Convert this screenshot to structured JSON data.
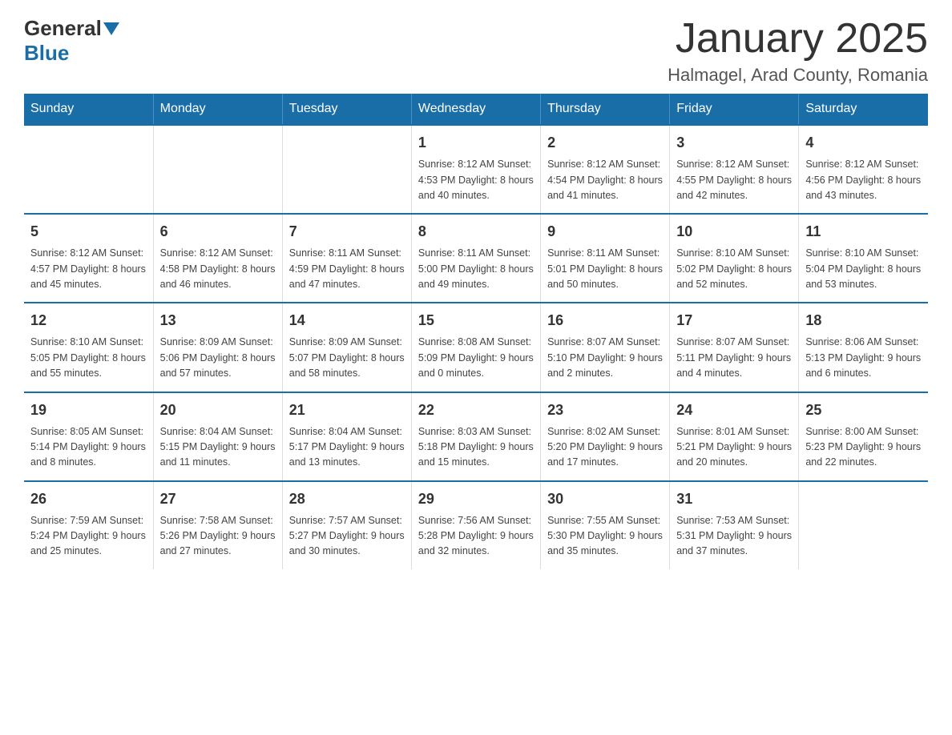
{
  "header": {
    "logo_general": "General",
    "logo_blue": "Blue",
    "title": "January 2025",
    "subtitle": "Halmagel, Arad County, Romania"
  },
  "days_of_week": [
    "Sunday",
    "Monday",
    "Tuesday",
    "Wednesday",
    "Thursday",
    "Friday",
    "Saturday"
  ],
  "weeks": [
    [
      {
        "day": "",
        "info": ""
      },
      {
        "day": "",
        "info": ""
      },
      {
        "day": "",
        "info": ""
      },
      {
        "day": "1",
        "info": "Sunrise: 8:12 AM\nSunset: 4:53 PM\nDaylight: 8 hours\nand 40 minutes."
      },
      {
        "day": "2",
        "info": "Sunrise: 8:12 AM\nSunset: 4:54 PM\nDaylight: 8 hours\nand 41 minutes."
      },
      {
        "day": "3",
        "info": "Sunrise: 8:12 AM\nSunset: 4:55 PM\nDaylight: 8 hours\nand 42 minutes."
      },
      {
        "day": "4",
        "info": "Sunrise: 8:12 AM\nSunset: 4:56 PM\nDaylight: 8 hours\nand 43 minutes."
      }
    ],
    [
      {
        "day": "5",
        "info": "Sunrise: 8:12 AM\nSunset: 4:57 PM\nDaylight: 8 hours\nand 45 minutes."
      },
      {
        "day": "6",
        "info": "Sunrise: 8:12 AM\nSunset: 4:58 PM\nDaylight: 8 hours\nand 46 minutes."
      },
      {
        "day": "7",
        "info": "Sunrise: 8:11 AM\nSunset: 4:59 PM\nDaylight: 8 hours\nand 47 minutes."
      },
      {
        "day": "8",
        "info": "Sunrise: 8:11 AM\nSunset: 5:00 PM\nDaylight: 8 hours\nand 49 minutes."
      },
      {
        "day": "9",
        "info": "Sunrise: 8:11 AM\nSunset: 5:01 PM\nDaylight: 8 hours\nand 50 minutes."
      },
      {
        "day": "10",
        "info": "Sunrise: 8:10 AM\nSunset: 5:02 PM\nDaylight: 8 hours\nand 52 minutes."
      },
      {
        "day": "11",
        "info": "Sunrise: 8:10 AM\nSunset: 5:04 PM\nDaylight: 8 hours\nand 53 minutes."
      }
    ],
    [
      {
        "day": "12",
        "info": "Sunrise: 8:10 AM\nSunset: 5:05 PM\nDaylight: 8 hours\nand 55 minutes."
      },
      {
        "day": "13",
        "info": "Sunrise: 8:09 AM\nSunset: 5:06 PM\nDaylight: 8 hours\nand 57 minutes."
      },
      {
        "day": "14",
        "info": "Sunrise: 8:09 AM\nSunset: 5:07 PM\nDaylight: 8 hours\nand 58 minutes."
      },
      {
        "day": "15",
        "info": "Sunrise: 8:08 AM\nSunset: 5:09 PM\nDaylight: 9 hours\nand 0 minutes."
      },
      {
        "day": "16",
        "info": "Sunrise: 8:07 AM\nSunset: 5:10 PM\nDaylight: 9 hours\nand 2 minutes."
      },
      {
        "day": "17",
        "info": "Sunrise: 8:07 AM\nSunset: 5:11 PM\nDaylight: 9 hours\nand 4 minutes."
      },
      {
        "day": "18",
        "info": "Sunrise: 8:06 AM\nSunset: 5:13 PM\nDaylight: 9 hours\nand 6 minutes."
      }
    ],
    [
      {
        "day": "19",
        "info": "Sunrise: 8:05 AM\nSunset: 5:14 PM\nDaylight: 9 hours\nand 8 minutes."
      },
      {
        "day": "20",
        "info": "Sunrise: 8:04 AM\nSunset: 5:15 PM\nDaylight: 9 hours\nand 11 minutes."
      },
      {
        "day": "21",
        "info": "Sunrise: 8:04 AM\nSunset: 5:17 PM\nDaylight: 9 hours\nand 13 minutes."
      },
      {
        "day": "22",
        "info": "Sunrise: 8:03 AM\nSunset: 5:18 PM\nDaylight: 9 hours\nand 15 minutes."
      },
      {
        "day": "23",
        "info": "Sunrise: 8:02 AM\nSunset: 5:20 PM\nDaylight: 9 hours\nand 17 minutes."
      },
      {
        "day": "24",
        "info": "Sunrise: 8:01 AM\nSunset: 5:21 PM\nDaylight: 9 hours\nand 20 minutes."
      },
      {
        "day": "25",
        "info": "Sunrise: 8:00 AM\nSunset: 5:23 PM\nDaylight: 9 hours\nand 22 minutes."
      }
    ],
    [
      {
        "day": "26",
        "info": "Sunrise: 7:59 AM\nSunset: 5:24 PM\nDaylight: 9 hours\nand 25 minutes."
      },
      {
        "day": "27",
        "info": "Sunrise: 7:58 AM\nSunset: 5:26 PM\nDaylight: 9 hours\nand 27 minutes."
      },
      {
        "day": "28",
        "info": "Sunrise: 7:57 AM\nSunset: 5:27 PM\nDaylight: 9 hours\nand 30 minutes."
      },
      {
        "day": "29",
        "info": "Sunrise: 7:56 AM\nSunset: 5:28 PM\nDaylight: 9 hours\nand 32 minutes."
      },
      {
        "day": "30",
        "info": "Sunrise: 7:55 AM\nSunset: 5:30 PM\nDaylight: 9 hours\nand 35 minutes."
      },
      {
        "day": "31",
        "info": "Sunrise: 7:53 AM\nSunset: 5:31 PM\nDaylight: 9 hours\nand 37 minutes."
      },
      {
        "day": "",
        "info": ""
      }
    ]
  ]
}
